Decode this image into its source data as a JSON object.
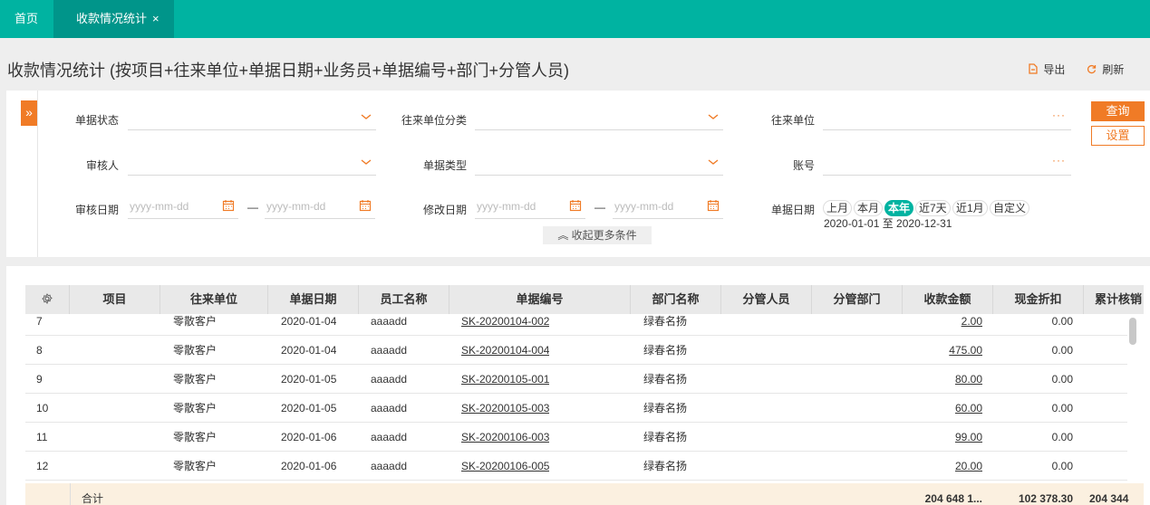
{
  "tabs": [
    {
      "label": "首页"
    },
    {
      "label": "收款情况统计",
      "close": "×"
    }
  ],
  "page": {
    "title": "收款情况统计 (按项目+往来单位+单据日期+业务员+单据编号+部门+分管人员)",
    "export_label": "导出",
    "refresh_label": "刷新"
  },
  "filters": {
    "collapse_icon": "»",
    "doc_status_label": "单据状态",
    "partner_category_label": "往来单位分类",
    "partner_label": "往来单位",
    "reviewer_label": "审核人",
    "doc_type_label": "单据类型",
    "account_label": "账号",
    "review_date_label": "审核日期",
    "modify_date_label": "修改日期",
    "doc_date_label": "单据日期",
    "date_placeholder": "yyyy-mm-dd",
    "range_sep": "—",
    "dots": "···",
    "periods": [
      "上月",
      "本月",
      "本年",
      "近7天",
      "近1月",
      "自定义"
    ],
    "active_period": "本年",
    "range_text": "2020-01-01 至 2020-12-31",
    "more_label": "收起更多条件",
    "more_icon": "︽",
    "query_button": "查询",
    "settings_button": "设置"
  },
  "grid": {
    "settings_icon": "gear-icon",
    "columns": [
      "项目",
      "往来单位",
      "单据日期",
      "员工名称",
      "单据编号",
      "部门名称",
      "分管人员",
      "分管部门",
      "收款金额",
      "现金折扣",
      "累计核销"
    ],
    "rows": [
      {
        "no": "7",
        "project": "",
        "partner": "零散客户",
        "date": "2020-01-04",
        "employee": "aaaadd",
        "doc_no": "SK-20200104-002",
        "dept": "绿春名扬",
        "manager": "",
        "mgr_dept": "",
        "amount": "2.00",
        "discount": "0.00"
      },
      {
        "no": "8",
        "project": "",
        "partner": "零散客户",
        "date": "2020-01-04",
        "employee": "aaaadd",
        "doc_no": "SK-20200104-004",
        "dept": "绿春名扬",
        "manager": "",
        "mgr_dept": "",
        "amount": "475.00",
        "discount": "0.00"
      },
      {
        "no": "9",
        "project": "",
        "partner": "零散客户",
        "date": "2020-01-05",
        "employee": "aaaadd",
        "doc_no": "SK-20200105-001",
        "dept": "绿春名扬",
        "manager": "",
        "mgr_dept": "",
        "amount": "80.00",
        "discount": "0.00"
      },
      {
        "no": "10",
        "project": "",
        "partner": "零散客户",
        "date": "2020-01-05",
        "employee": "aaaadd",
        "doc_no": "SK-20200105-003",
        "dept": "绿春名扬",
        "manager": "",
        "mgr_dept": "",
        "amount": "60.00",
        "discount": "0.00"
      },
      {
        "no": "11",
        "project": "",
        "partner": "零散客户",
        "date": "2020-01-06",
        "employee": "aaaadd",
        "doc_no": "SK-20200106-003",
        "dept": "绿春名扬",
        "manager": "",
        "mgr_dept": "",
        "amount": "99.00",
        "discount": "0.00"
      },
      {
        "no": "12",
        "project": "",
        "partner": "零散客户",
        "date": "2020-01-06",
        "employee": "aaaadd",
        "doc_no": "SK-20200106-005",
        "dept": "绿春名扬",
        "manager": "",
        "mgr_dept": "",
        "amount": "20.00",
        "discount": "0.00"
      }
    ],
    "footer": {
      "label": "合计",
      "amount": "204 648 1...",
      "discount": "102 378.30",
      "writeoff": "204 344"
    }
  },
  "colors": {
    "teal": "#00b3a1",
    "teal_dark": "#00958a",
    "orange": "#f07b26"
  }
}
